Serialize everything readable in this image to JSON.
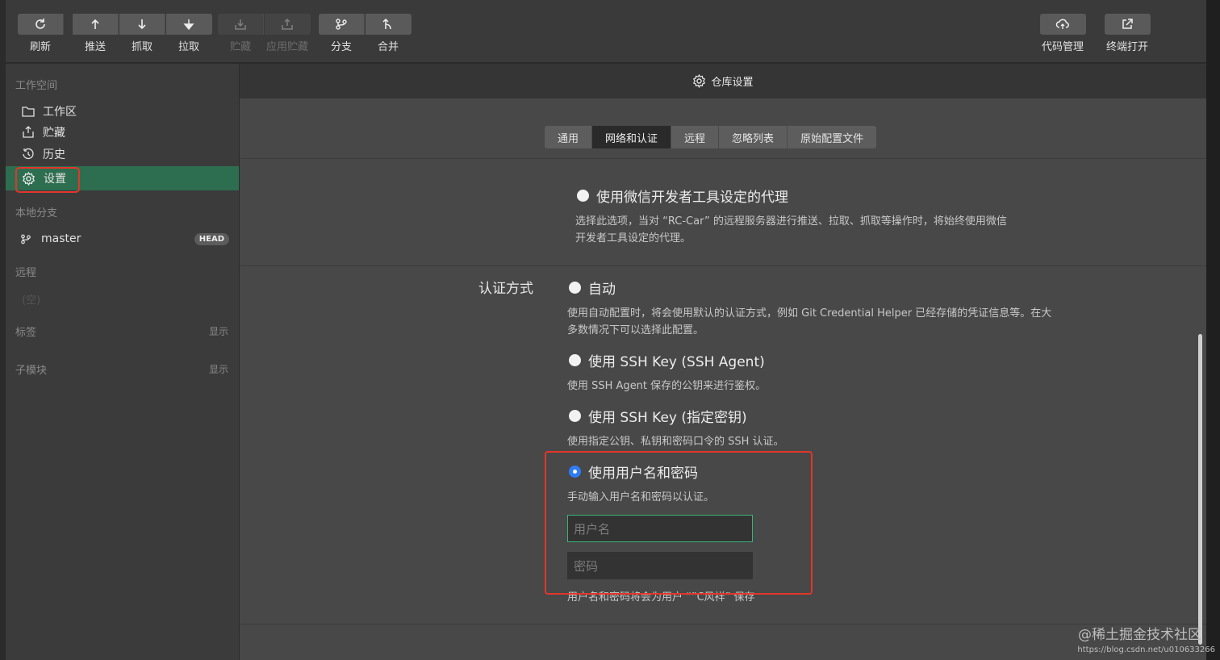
{
  "toolbar": {
    "buttons": [
      {
        "label": "刷新",
        "icon": "refresh-icon"
      },
      {
        "label": "推送",
        "icon": "push-icon"
      },
      {
        "label": "抓取",
        "icon": "fetch-icon"
      },
      {
        "label": "拉取",
        "icon": "pull-icon"
      },
      {
        "label": "贮藏",
        "icon": "stash-icon",
        "disabled": true
      },
      {
        "label": "应用贮藏",
        "icon": "apply-stash-icon",
        "disabled": true
      },
      {
        "label": "分支",
        "icon": "branch-icon"
      },
      {
        "label": "合并",
        "icon": "merge-icon"
      }
    ],
    "right_buttons": [
      {
        "label": "代码管理",
        "icon": "cloud-icon"
      },
      {
        "label": "终端打开",
        "icon": "external-link-icon"
      }
    ]
  },
  "sidebar": {
    "workspace_title": "工作空间",
    "items": [
      {
        "label": "工作区",
        "icon": "folder-icon"
      },
      {
        "label": "贮藏",
        "icon": "stash-icon"
      },
      {
        "label": "历史",
        "icon": "history-icon"
      },
      {
        "label": "设置",
        "icon": "gear-icon",
        "active": true
      }
    ],
    "local_branches_title": "本地分支",
    "branch": {
      "name": "master",
      "badge": "HEAD"
    },
    "remote_title": "远程",
    "remote_empty": "(空)",
    "tags_title": "标签",
    "tags_action": "显示",
    "submodules_title": "子模块",
    "submodules_action": "显示"
  },
  "main": {
    "header_title": "仓库设置",
    "tabs": [
      {
        "label": "通用"
      },
      {
        "label": "网络和认证",
        "active": true
      },
      {
        "label": "远程"
      },
      {
        "label": "忽略列表"
      },
      {
        "label": "原始配置文件"
      }
    ],
    "proxy": {
      "label": "使用微信开发者工具设定的代理",
      "desc1": "选择此选项，当对 “RC-Car” 的远程服务器进行推送、拉取、抓取等操作时，将始终使用微信",
      "desc2": "开发者工具设定的代理。"
    },
    "auth": {
      "section_label": "认证方式",
      "options": [
        {
          "label": "自动",
          "desc1": "使用自动配置时，将会使用默认的认证方式，例如 Git Credential Helper 已经存储的凭证信息等。在大",
          "desc2": "多数情况下可以选择此配置。"
        },
        {
          "label": "使用 SSH Key (SSH Agent)",
          "desc1": "使用 SSH Agent 保存的公钥来进行鉴权。"
        },
        {
          "label": "使用 SSH Key (指定密钥)",
          "desc1": "使用指定公钥、私钥和密码口令的 SSH 认证。"
        },
        {
          "label": "使用用户名和密码",
          "desc1": "手动输入用户名和密码以认证。",
          "checked": true
        }
      ],
      "username_placeholder": "用户名",
      "password_placeholder": "密码",
      "save_note": "用户名和密码将会为用户 “”C风祥” 保存"
    }
  },
  "watermark": "@稀土掘金技术社区",
  "url_note": "https://blog.csdn.net/u010633266",
  "colors": {
    "accent_green": "#2e6e50",
    "highlight_red": "#e2362b",
    "radio_blue": "#2f7cf6"
  }
}
